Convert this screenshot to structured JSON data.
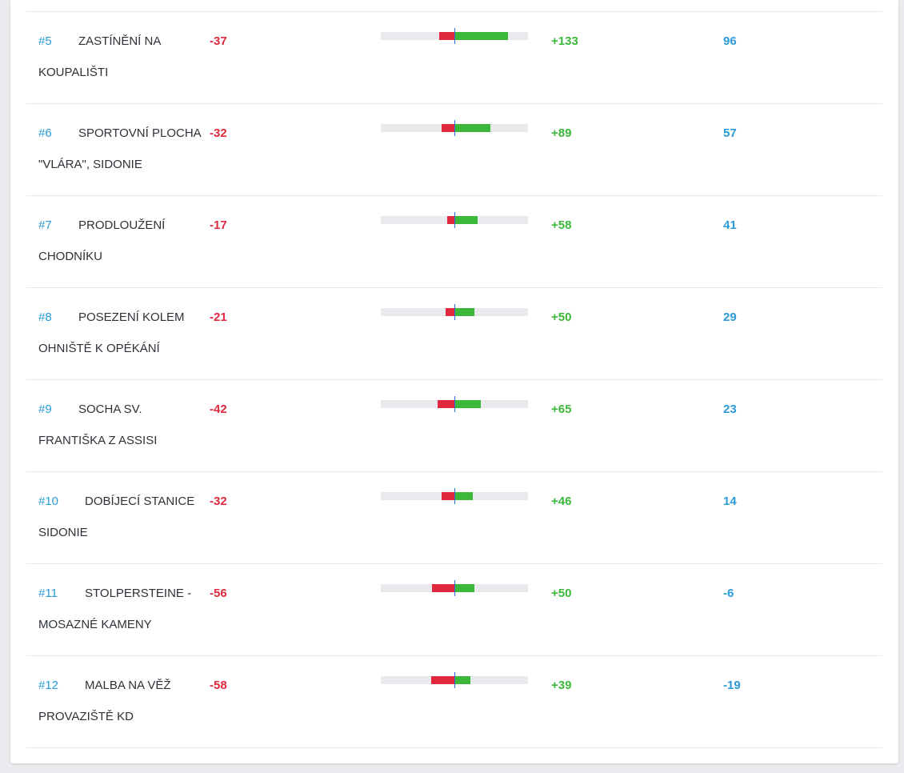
{
  "colors": {
    "negative": "#e0283e",
    "positive": "#3bb83a",
    "accent": "#2a9bd7",
    "track": "#e8eaed"
  },
  "bar_scale_max": 133,
  "rows": [
    {
      "num": "#5",
      "name": "ZASTÍNĚNÍ NA KOUPALIŠTI",
      "minus": "-37",
      "plus": "+133",
      "total": "96",
      "neg_value": 37,
      "pos_value": 133
    },
    {
      "num": "#6",
      "name": "SPORTOVNÍ PLOCHA \"VLÁRA\", SIDONIE",
      "minus": "-32",
      "plus": "+89",
      "total": "57",
      "neg_value": 32,
      "pos_value": 89
    },
    {
      "num": "#7",
      "name": "PRODLOUŽENÍ CHODNÍKU",
      "minus": "-17",
      "plus": "+58",
      "total": "41",
      "neg_value": 17,
      "pos_value": 58
    },
    {
      "num": "#8",
      "name": "POSEZENÍ KOLEM OHNIŠTĚ K OPÉKÁNÍ",
      "minus": "-21",
      "plus": "+50",
      "total": "29",
      "neg_value": 21,
      "pos_value": 50
    },
    {
      "num": "#9",
      "name": "SOCHA SV. FRANTIŠKA Z ASSISI",
      "minus": "-42",
      "plus": "+65",
      "total": "23",
      "neg_value": 42,
      "pos_value": 65
    },
    {
      "num": "#10",
      "name": "DOBÍJECÍ STANICE SIDONIE",
      "minus": "-32",
      "plus": "+46",
      "total": "14",
      "neg_value": 32,
      "pos_value": 46
    },
    {
      "num": "#11",
      "name": "STOLPERSTEINE - MOSAZNÉ KAMENY",
      "minus": "-56",
      "plus": "+50",
      "total": "-6",
      "neg_value": 56,
      "pos_value": 50
    },
    {
      "num": "#12",
      "name": "MALBA NA VĚŽ PROVAZIŠTĚ KD",
      "minus": "-58",
      "plus": "+39",
      "total": "-19",
      "neg_value": 58,
      "pos_value": 39
    }
  ]
}
